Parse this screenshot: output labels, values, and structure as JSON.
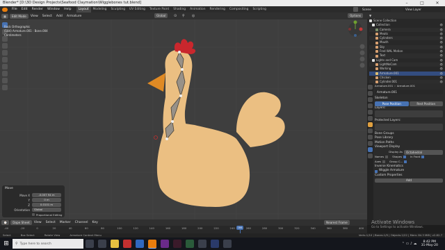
{
  "window": {
    "title": "Blender* [D:\\3D Design Projects\\Seafood Claymation\\Wigglebones tut.blend]",
    "controls": [
      "–",
      "□",
      "✕"
    ]
  },
  "menubar": {
    "menus": [
      "File",
      "Edit",
      "Render",
      "Window",
      "Help"
    ],
    "workspaces": [
      "Layout",
      "Modeling",
      "Sculpting",
      "UV Editing",
      "Texture Paint",
      "Shading",
      "Animation",
      "Rendering",
      "Compositing",
      "Scripting"
    ],
    "active_workspace": "Layout",
    "scene": "Scene",
    "view_layer": "View Layer"
  },
  "viewport": {
    "header": {
      "mode": "Edit Mode",
      "menus": [
        "View",
        "Select",
        "Add",
        "Armature"
      ],
      "transform": "Global",
      "options": "Options"
    },
    "overlay_text": {
      "view": "Back Orthographic",
      "object": "(184) Armature.001 : Bone.004",
      "units": "Centimeters"
    }
  },
  "operator_panel": {
    "title": "Move",
    "fields": [
      {
        "label": "Move X",
        "value": "-0.007 94 m"
      },
      {
        "label": "Y",
        "value": "0 m"
      },
      {
        "label": "Z",
        "value": "0.0101 m"
      }
    ],
    "orientation_label": "Orientation",
    "orientation_value": "Global",
    "proportional": "Proportional Editing"
  },
  "outliner": {
    "root": "Scene Collection",
    "rows": [
      {
        "label": "Collection",
        "color": "#e0e0e0",
        "selected": false
      },
      {
        "label": "Camera",
        "color": "#7a8f6a",
        "selected": false
      },
      {
        "label": "Meats",
        "color": "#d8a070",
        "selected": false
      },
      {
        "label": "Cylinders",
        "color": "#d8a070",
        "selected": false
      },
      {
        "label": "Mouth",
        "color": "#d8a070",
        "selected": false
      },
      {
        "label": "Sky",
        "color": "#d8a070",
        "selected": false
      },
      {
        "label": "Fred WAL Motion",
        "color": "#d8a070",
        "selected": false
      },
      {
        "label": "Text",
        "color": "#d8a070",
        "selected": false
      },
      {
        "label": "Lights and Cam",
        "color": "#e0e0e0",
        "selected": false
      },
      {
        "label": "LightNoCam",
        "color": "#d8a070",
        "selected": false
      },
      {
        "label": "Working",
        "color": "#d8a070",
        "selected": false
      },
      {
        "label": "Armature.001",
        "color": "#e0c070",
        "selected": true
      },
      {
        "label": "Chicken",
        "color": "#d8a070",
        "selected": false
      },
      {
        "label": "Cylinder.001",
        "color": "#d8a070",
        "selected": false
      }
    ]
  },
  "properties": {
    "breadcrumb": [
      "Armature.001",
      "Armature.001"
    ],
    "object_name": "Armature.001",
    "sections": {
      "skeleton": "Skeleton",
      "pose_position": "Pose Position",
      "rest_position": "Rest Position",
      "layers": "Layers:",
      "protected_layers": "Protected Layers:",
      "bone_groups": "Bone Groups",
      "pose_library": "Pose Library",
      "motion_paths": "Motion Paths",
      "viewport_display": "Viewport Display",
      "display_as_label": "Display As",
      "display_as_value": "Octahedral",
      "names": "Names",
      "shapes": "Shapes",
      "in_front": "In Front",
      "axes": "Axes",
      "group_colors": "Group C...",
      "inverse_kinematics": "Inverse Kinematics",
      "wiggle_armature": "Wiggle Armature",
      "custom_properties": "Custom Properties",
      "add": "Add"
    }
  },
  "timeline": {
    "menus": [
      "Dope Sheet",
      "View",
      "Select",
      "Marker",
      "Channel",
      "Key"
    ],
    "keying": "Nearest Frame",
    "ticks": [
      "-40",
      "-20",
      "0",
      "20",
      "40",
      "60",
      "80",
      "100",
      "120",
      "140",
      "160",
      "180",
      "200",
      "220",
      "240",
      "260",
      "280",
      "300",
      "320",
      "340",
      "360",
      "380",
      "400"
    ],
    "current_frame": "184"
  },
  "statusbar": {
    "left": [
      "Select",
      "Box Select",
      "Rotate View",
      "Armature Context Menu"
    ],
    "right": "Verts:1/10 | Bones:1/5 | Objects:1/22 | Mem: 84.3 MiB | v2.82.7"
  },
  "activation": {
    "title": "Activate Windows",
    "subtitle": "Go to Settings to activate Windows."
  },
  "taskbar": {
    "search_placeholder": "Type here to search",
    "time": "8:42 PM",
    "date": "31-May-20"
  },
  "colors": {
    "accent": "#4772b3",
    "chicken": "#ebbf82",
    "comb": "#c9272d",
    "beak": "#e08a24"
  }
}
